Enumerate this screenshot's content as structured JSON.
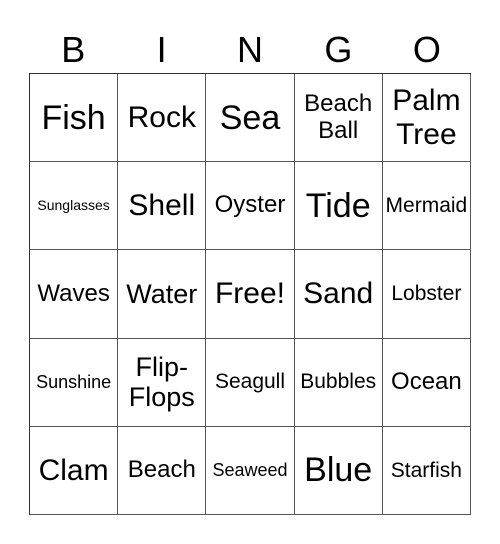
{
  "header": {
    "letters": [
      "B",
      "I",
      "N",
      "G",
      "O"
    ]
  },
  "card": {
    "rows": [
      [
        "Fish",
        "Rock",
        "Sea",
        "Beach Ball",
        "Palm Tree"
      ],
      [
        "Sunglasses",
        "Shell",
        "Oyster",
        "Tide",
        "Mermaid"
      ],
      [
        "Waves",
        "Water",
        "Free!",
        "Sand",
        "Lobster"
      ],
      [
        "Sunshine",
        "Flip-Flops",
        "Seagull",
        "Bubbles",
        "Ocean"
      ],
      [
        "Clam",
        "Beach",
        "Seaweed",
        "Blue",
        "Starfish"
      ]
    ]
  }
}
